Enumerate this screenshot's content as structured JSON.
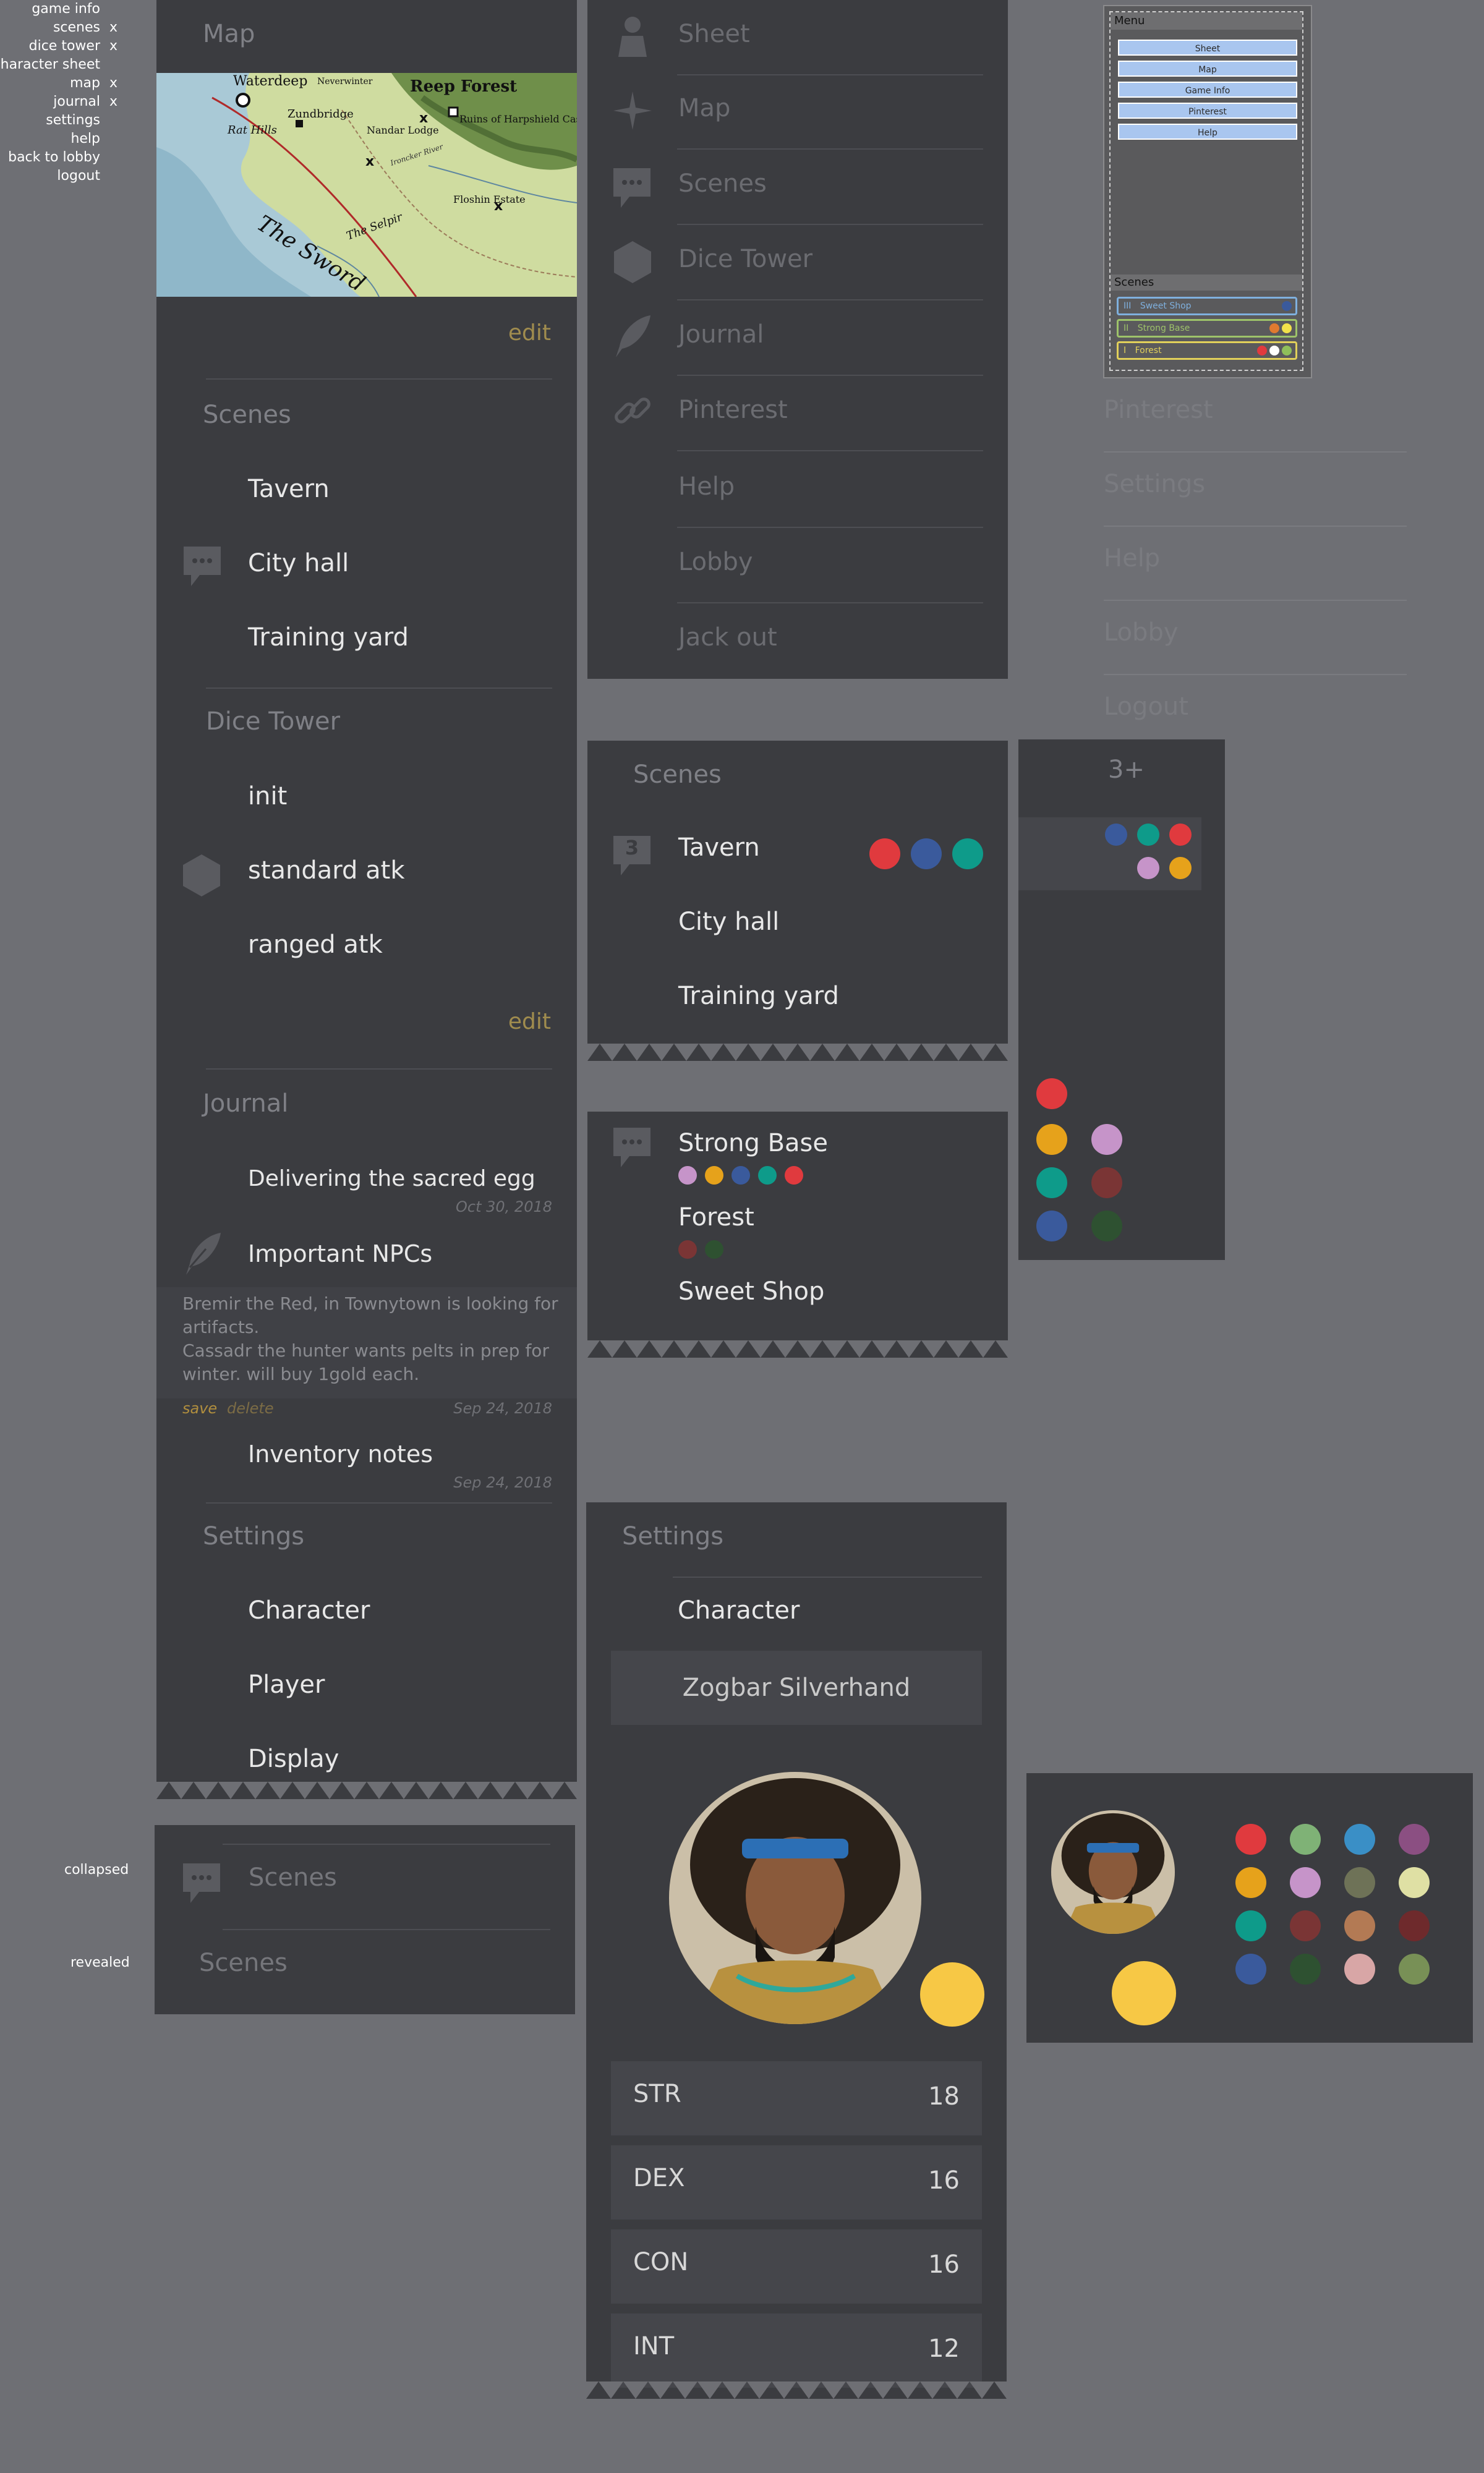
{
  "legend": [
    {
      "label": "game info",
      "x": ""
    },
    {
      "label": "scenes",
      "x": "x"
    },
    {
      "label": "dice tower",
      "x": "x"
    },
    {
      "label": "character sheet",
      "x": ""
    },
    {
      "label": "map",
      "x": "x"
    },
    {
      "label": "journal",
      "x": "x"
    },
    {
      "label": "settings",
      "x": ""
    },
    {
      "label": "help",
      "x": ""
    },
    {
      "label": "back to lobby",
      "x": ""
    },
    {
      "label": "logout",
      "x": ""
    }
  ],
  "panel1": {
    "map_title": "Map",
    "map_labels": [
      "Waterdeep",
      "Zundbridge",
      "Rat Hills",
      "Nandar Lodge",
      "Ruins of Harpshield Castle",
      "Floshin Estate",
      "The Sword",
      "The Selpir",
      "Neverwinter",
      "Reep Forest",
      "Ironcker River"
    ],
    "map_edit": "edit",
    "scenes_title": "Scenes",
    "scenes": [
      "Tavern",
      "City hall",
      "Training yard"
    ],
    "dice_title": "Dice Tower",
    "dice": [
      "init",
      "standard atk",
      "ranged atk"
    ],
    "dice_edit": "edit",
    "journal_title": "Journal",
    "journal": [
      {
        "title": "Delivering the sacred egg",
        "date": "Oct 30, 2018"
      },
      {
        "title": "Important NPCs"
      },
      {
        "title": "Inventory notes",
        "date": "Sep 24, 2018"
      }
    ],
    "note_text_1": "Bremir the Red, in Townytown is looking for",
    "note_text_2": "artifacts.",
    "note_text_3": "Cassadr the hunter wants pelts in prep for",
    "note_text_4": "winter. will buy 1gold each.",
    "note_save": "save",
    "note_delete": "delete",
    "note_date": "Sep 24, 2018",
    "settings_title": "Settings",
    "settings": [
      "Character",
      "Player",
      "Display"
    ]
  },
  "collapsed_panel": {
    "label_collapsed": "collapsed",
    "label_revealed": "revealed",
    "scenes_collapsed": "Scenes",
    "scenes_revealed": "Scenes"
  },
  "nav_panel": {
    "items": [
      "Sheet",
      "Map",
      "Scenes",
      "Dice Tower",
      "Journal",
      "Pinterest",
      "Help",
      "Lobby",
      "Jack out"
    ]
  },
  "mini_menu": {
    "title": "Menu",
    "buttons": [
      "Sheet",
      "Map",
      "Game Info",
      "Pinterest",
      "Help"
    ],
    "scenes_title": "Scenes",
    "scenes": [
      {
        "num": "III",
        "name": "Sweet Shop"
      },
      {
        "num": "II",
        "name": "Strong Base"
      },
      {
        "num": "I",
        "name": "Forest"
      }
    ]
  },
  "faded_menu": {
    "items": [
      "Pinterest",
      "Settings",
      "Help",
      "Lobby",
      "Logout"
    ]
  },
  "scenes_panel": {
    "title": "Scenes",
    "badge": "3",
    "items": [
      "Tavern",
      "City hall",
      "Training yard"
    ]
  },
  "players_panel": {
    "label": "3+"
  },
  "scenes2_panel": {
    "items": [
      "Strong Base",
      "Forest",
      "Sweet Shop"
    ]
  },
  "settings_panel": {
    "title": "Settings",
    "character_label": "Character",
    "character_name": "Zogbar Silverhand",
    "stats": [
      {
        "k": "STR",
        "v": "18"
      },
      {
        "k": "DEX",
        "v": "16"
      },
      {
        "k": "CON",
        "v": "16"
      },
      {
        "k": "INT",
        "v": "12"
      }
    ]
  },
  "colors": {
    "accent_edit": "#a08c4e",
    "player_yellow": "#f7c845",
    "palette": [
      "#e03a3e",
      "#7fb276",
      "#3a8fc6",
      "#8b4f82",
      "#e6a21b",
      "#c694c9",
      "#6e7257",
      "#dfe0a4",
      "#0e9b8a",
      "#7a3535",
      "#b37a54",
      "#6e2a2c",
      "#3a5a9c",
      "#2e5131",
      "#d8a6a6",
      "#789056"
    ]
  }
}
